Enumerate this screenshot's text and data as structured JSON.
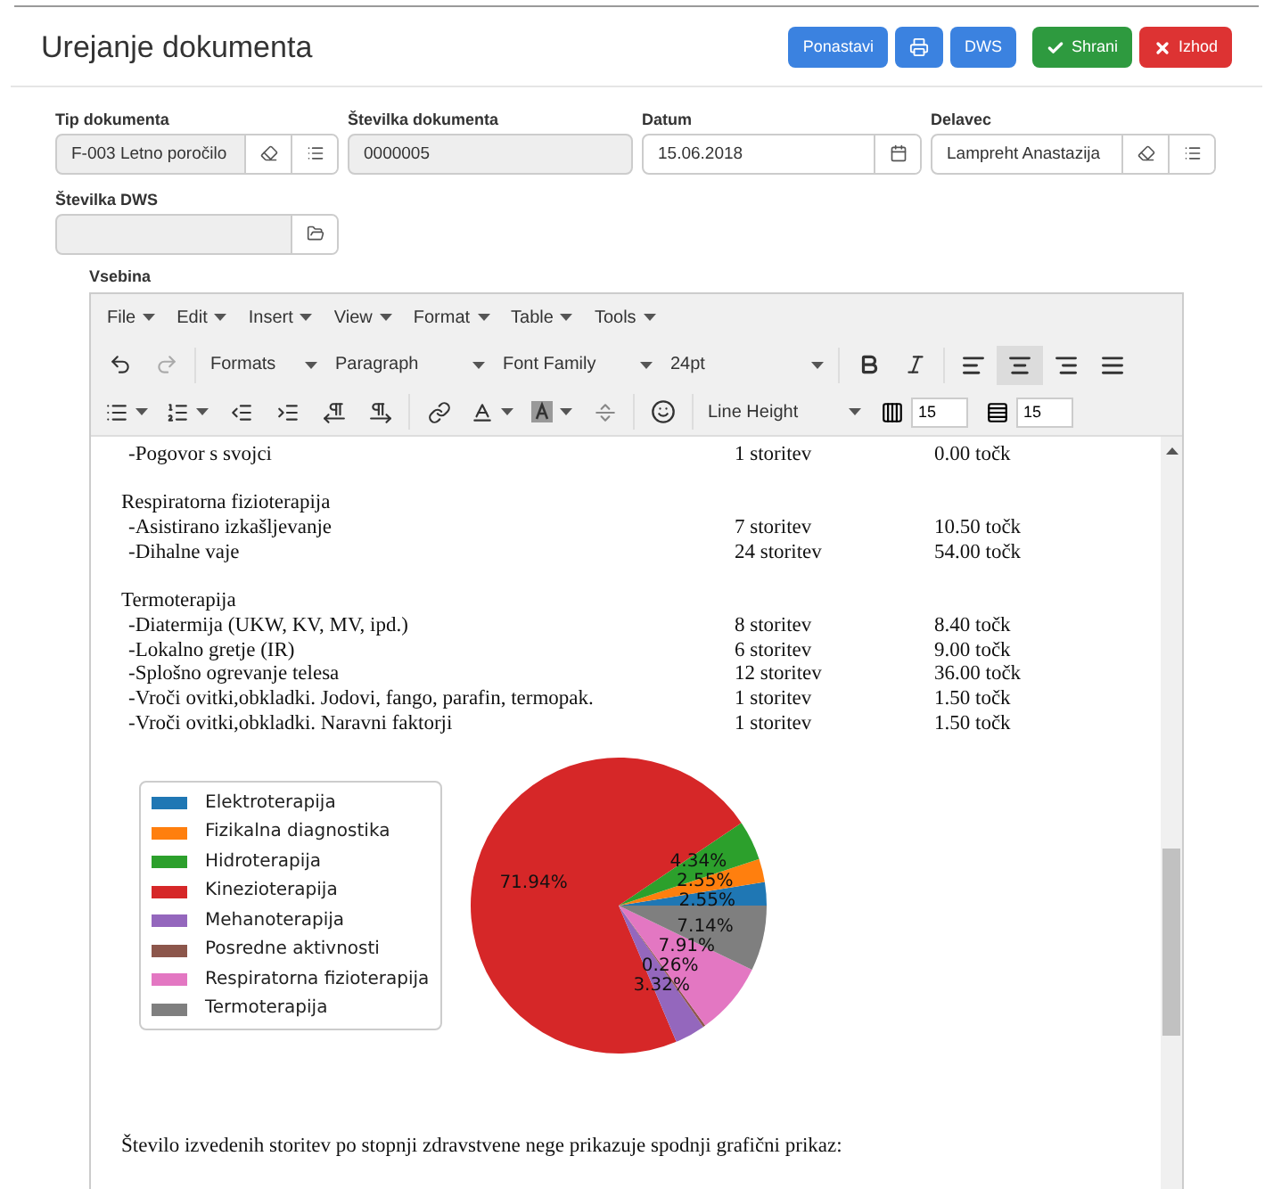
{
  "title": "Urejanje dokumenta",
  "header_buttons": [
    {
      "kind": "text",
      "label": "Ponastavi",
      "color": "#3b82e0"
    },
    {
      "kind": "print",
      "color": "#3b82e0"
    },
    {
      "kind": "text",
      "label": "DWS",
      "color": "#3b82e0"
    },
    {
      "kind": "save",
      "label": "Shrani",
      "color": "#2e9a3f"
    },
    {
      "kind": "exit",
      "label": "Izhod",
      "color": "#dd3333"
    }
  ],
  "fields": [
    {
      "label": "Tip dokumenta",
      "value": "F-003 Letno poročilo",
      "readonly": true,
      "kind": "lookup"
    },
    {
      "label": "Številka dokumenta",
      "value": "0000005",
      "readonly": true,
      "kind": "plain"
    },
    {
      "label": "Datum",
      "value": "15.06.2018",
      "readonly": false,
      "kind": "date"
    },
    {
      "label": "Delavec",
      "value": "Lampreht Anastazija",
      "readonly": false,
      "kind": "lookup"
    },
    {
      "label": "Številka DWS",
      "readonly": true,
      "kind": "folder"
    }
  ],
  "editor": {
    "label": "Vsebina",
    "menus": [
      "File",
      "Edit",
      "Insert",
      "View",
      "Format",
      "Table",
      "Tools"
    ],
    "toolbar": {
      "formats": "Formats",
      "block": "Paragraph",
      "font": "Font Family",
      "size": "24pt",
      "align": [
        {
          "selected": false
        },
        {
          "selected": true
        },
        {
          "selected": false
        },
        {
          "selected": false
        }
      ],
      "line_height": "Line Height",
      "col_value": "15",
      "row_value": "15"
    },
    "groups": [
      {
        "rows": [
          {
            "name": "-Pogovor s svojci",
            "count": "1 storitev",
            "points": "0.00 točk"
          }
        ]
      },
      {
        "heading": "Respiratorna fizioterapija",
        "rows": [
          {
            "name": "-Asistirano izkašljevanje",
            "count": "7 storitev",
            "points": "10.50 točk"
          },
          {
            "name": "-Dihalne vaje",
            "count": "24 storitev",
            "points": "54.00 točk"
          }
        ]
      },
      {
        "heading": "Termoterapija",
        "rows": [
          {
            "name": "-Diatermija (UKW, KV, MV, ipd.)",
            "count": "8 storitev",
            "points": "8.40 točk"
          },
          {
            "name": "-Lokalno gretje (IR)",
            "count": "6 storitev",
            "points": "9.00 točk"
          },
          {
            "name": "-Splošno ogrevanje telesa",
            "count": "12 storitev",
            "points": "36.00 točk"
          },
          {
            "name": "-Vroči ovitki,obkladki. Jodovi, fango, parafin, termopak.",
            "count": "1 storitev",
            "points": "1.50 točk"
          },
          {
            "name": "-Vroči ovitki,obkladki. Naravni faktorji",
            "count": "1 storitev",
            "points": "1.50 točk"
          }
        ]
      }
    ],
    "chart_data": {
      "type": "pie",
      "legend": "left",
      "categories": [
        "Elektroterapija",
        "Fizikalna diagnostika",
        "Hidroterapija",
        "Kinezioterapija",
        "Mehanoterapija",
        "Posredne aktivnosti",
        "Respiratorna fizioterapija",
        "Termoterapija"
      ],
      "series": [
        {
          "colors": [
            "#1f77b4",
            "#ff7f0e",
            "#2ca02c",
            "#d62728",
            "#9467bd",
            "#8c564b",
            "#e377c2",
            "#7f7f7f"
          ],
          "values": [
            2.55,
            2.55,
            4.34,
            71.94,
            3.32,
            0.26,
            7.91,
            7.14
          ]
        }
      ],
      "value_labels": [
        "2.55%",
        "2.55%",
        "4.34%",
        "71.94%",
        "3.32%",
        "0.26%",
        "7.91%",
        "7.14%"
      ]
    },
    "closing": "Število izvedenih storitev po stopnji zdravstvene nege prikazuje spodnji grafični prikaz:"
  }
}
